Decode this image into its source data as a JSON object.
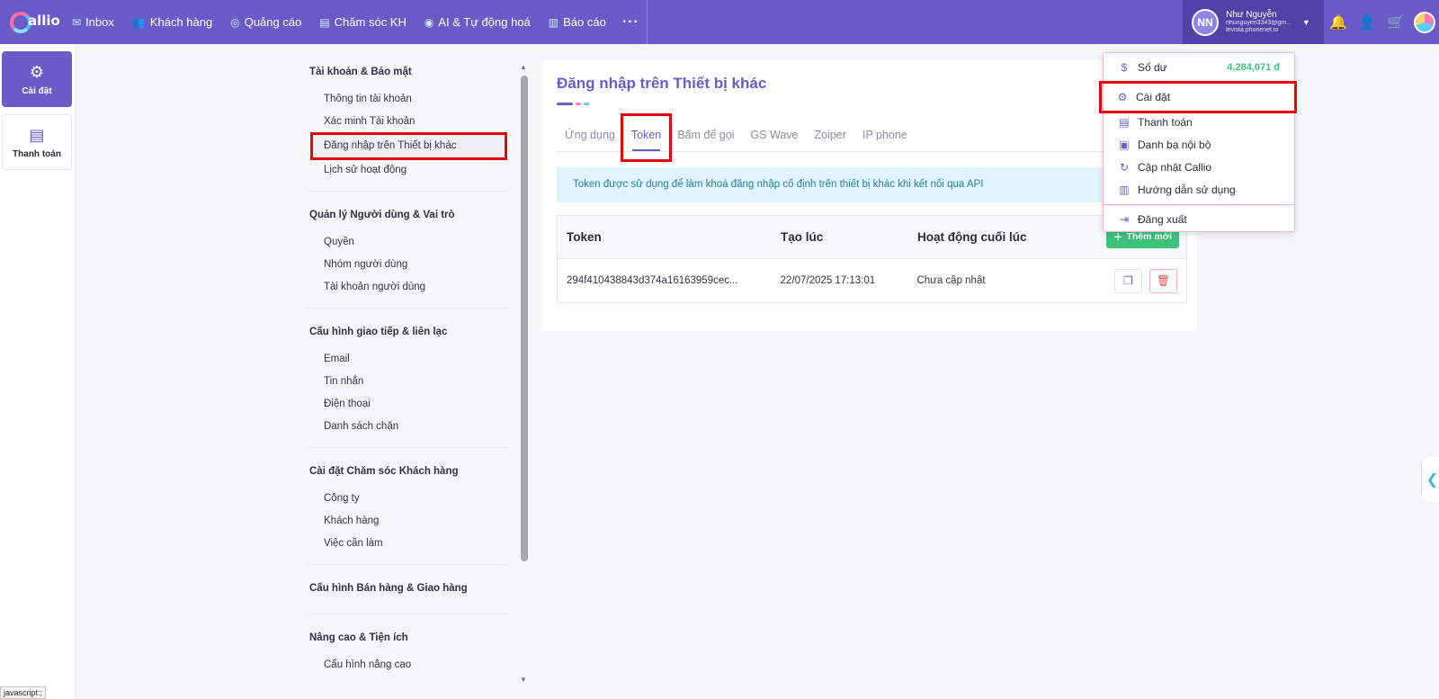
{
  "app": {
    "logo_text": "allio"
  },
  "nav": [
    {
      "label": "Inbox",
      "icon": "inbox-icon"
    },
    {
      "label": "Khách hàng",
      "icon": "customers-icon"
    },
    {
      "label": "Quảng cáo",
      "icon": "ads-icon"
    },
    {
      "label": "Chăm sóc KH",
      "icon": "support-icon"
    },
    {
      "label": "AI & Tự động hoá",
      "icon": "automation-icon"
    },
    {
      "label": "Báo cáo",
      "icon": "report-icon"
    }
  ],
  "nav_more": "···",
  "user": {
    "initials": "NN",
    "name": "Như Nguyễn",
    "email": "nhunguyen3343@gm...",
    "domain": "levista.phonenet.io"
  },
  "rail": [
    {
      "label": "Cài đặt",
      "icon": "gear-icon",
      "active": true
    },
    {
      "label": "Thanh toán",
      "icon": "receipt-icon",
      "active": false
    }
  ],
  "menu": {
    "sections": [
      {
        "heading": "Tài khoản & Bảo mật",
        "items": [
          "Thông tin tài khoản",
          "Xác minh Tài khoản",
          "Đăng nhập trên Thiết bị khác",
          "Lịch sử hoạt động"
        ]
      },
      {
        "heading": "Quản lý Người dùng & Vai trò",
        "items": [
          "Quyền",
          "Nhóm người dùng",
          "Tài khoản người dùng"
        ]
      },
      {
        "heading": "Cấu hình giao tiếp & liên lạc",
        "items": [
          "Email",
          "Tin nhắn",
          "Điện thoại",
          "Danh sách chặn"
        ]
      },
      {
        "heading": "Cài đặt Chăm sóc Khách hàng",
        "items": [
          "Công ty",
          "Khách hàng",
          "Việc cần làm"
        ]
      },
      {
        "heading": "Cấu hình Bán hàng & Giao hàng",
        "items": []
      },
      {
        "heading": "Nâng cao & Tiện ích",
        "items": [
          "Cấu hình nâng cao"
        ]
      }
    ]
  },
  "content": {
    "title": "Đăng nhập trên Thiết bị khác",
    "tabs": [
      "Ứng dụng",
      "Token",
      "Bấm để gọi",
      "GS Wave",
      "Zoiper",
      "IP phone"
    ],
    "active_tab": "Token",
    "info": "Token được sử dụng để làm khoá đăng nhập cố định trên thiết bị khác khi kết nối qua API",
    "table": {
      "headers": [
        "Token",
        "Tạo lúc",
        "Hoạt động cuối lúc"
      ],
      "add_label": "Thêm mới",
      "rows": [
        {
          "token": "294f410438843d374a16163959cec...",
          "created": "22/07/2025 17:13:01",
          "last_active": "Chưa cập nhật"
        }
      ]
    }
  },
  "dropdown": {
    "balance_label": "Số dư",
    "balance_value": "4,284,071 đ",
    "items": [
      {
        "label": "Cài đặt",
        "icon": "gear-icon"
      },
      {
        "label": "Thanh toán",
        "icon": "document-icon"
      },
      {
        "label": "Danh bạ nội bộ",
        "icon": "contacts-icon"
      },
      {
        "label": "Cập nhật Callio",
        "icon": "refresh-icon"
      },
      {
        "label": "Hướng dẫn sử dụng",
        "icon": "book-icon"
      }
    ],
    "logout_label": "Đăng xuất"
  },
  "status_tip": "javascript:;",
  "colors": {
    "brand": "#6a5cc8",
    "success": "#3ec17b",
    "highlight": "#e8000d"
  }
}
